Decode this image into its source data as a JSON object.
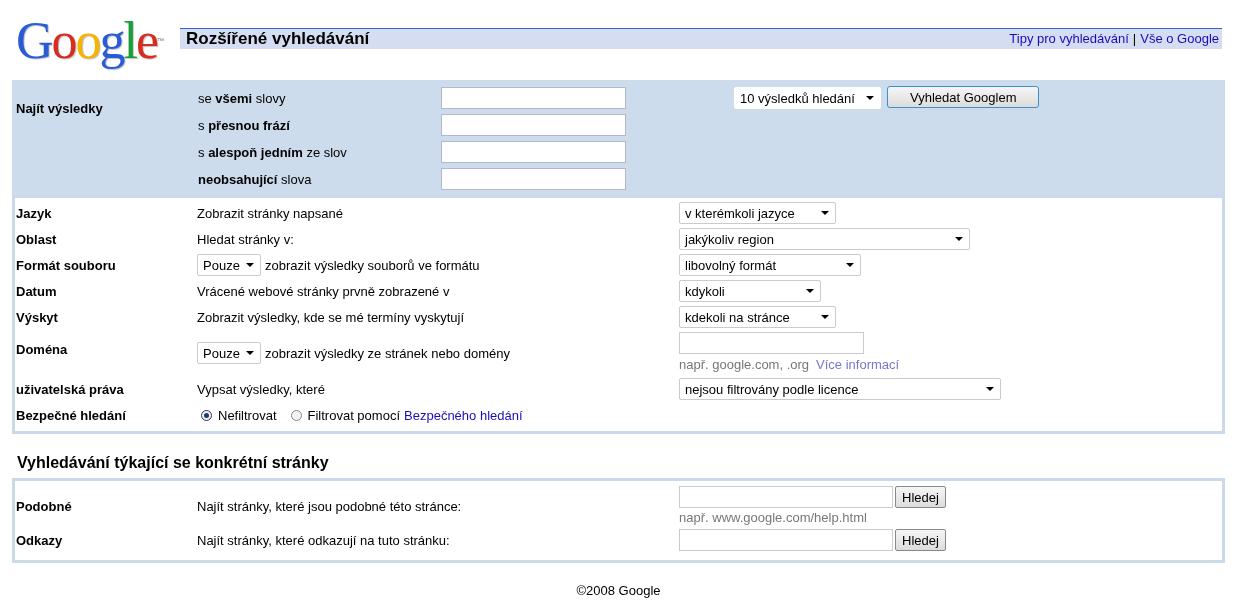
{
  "header": {
    "logo": "Google",
    "trademark": "™",
    "title": "Rozšířené vyhledávání",
    "links": [
      "Tipy pro vyhledávání",
      "Vše o Google"
    ],
    "separator": "|"
  },
  "find": {
    "label": "Najít výsledky",
    "fields": [
      {
        "label": "se **všemi** slovy"
      },
      {
        "label": "s **přesnou frází**"
      },
      {
        "label": "s **alespoň jedním** ze slov"
      },
      {
        "label": "**neobsahující** slova"
      }
    ],
    "results_select": "10 výsledků hledání",
    "search_button": "Vyhledat Googlem"
  },
  "options": [
    {
      "kind": "select",
      "label": "Jazyk",
      "description": "Zobrazit stránky napsané",
      "value": "v kterémkoli jazyce"
    },
    {
      "kind": "select",
      "label": "Oblast",
      "description": "Hledat stránky v:",
      "value": "jakýkoliv region"
    },
    {
      "kind": "select",
      "label": "Formát souboru",
      "prefix_select": "Pouze",
      "description": "zobrazit výsledky souborů ve formátu",
      "value": "libovolný formát"
    },
    {
      "kind": "select",
      "label": "Datum",
      "description": "Vrácené webové stránky prvně zobrazené v",
      "value": "kdykoli"
    },
    {
      "kind": "select",
      "label": "Výskyt",
      "description": "Zobrazit výsledky, kde se mé termíny vyskytují",
      "value": "kdekoli na stránce"
    },
    {
      "kind": "domain",
      "label": "Doména",
      "prefix_select": "Pouze",
      "description": "zobrazit výsledky ze stránek nebo domény",
      "hint": "např. google.com, .org",
      "link": "Více informací"
    },
    {
      "kind": "select",
      "label": "uživatelská práva",
      "description": "Vypsat výsledky, které",
      "value": "nejsou filtrovány podle licence"
    },
    {
      "kind": "radio",
      "label": "Bezpečné hledání",
      "radios": [
        {
          "label": "Nefiltrovat",
          "selected": true
        },
        {
          "label": "Filtrovat pomocí",
          "link": "Bezpečného hledání",
          "selected": false
        }
      ]
    }
  ],
  "page_search": {
    "title": "Vyhledávání týkající se konkrétní stránky",
    "rows": [
      {
        "label": "Podobné",
        "description": "Najít stránky, které jsou podobné této stránce:",
        "button": "Hledej",
        "hint": "např. www.google.com/help.html"
      },
      {
        "label": "Odkazy",
        "description": "Najít stránky, které odkazují na tuto stránku:",
        "button": "Hledej"
      }
    ]
  },
  "footer": "©2008 Google"
}
